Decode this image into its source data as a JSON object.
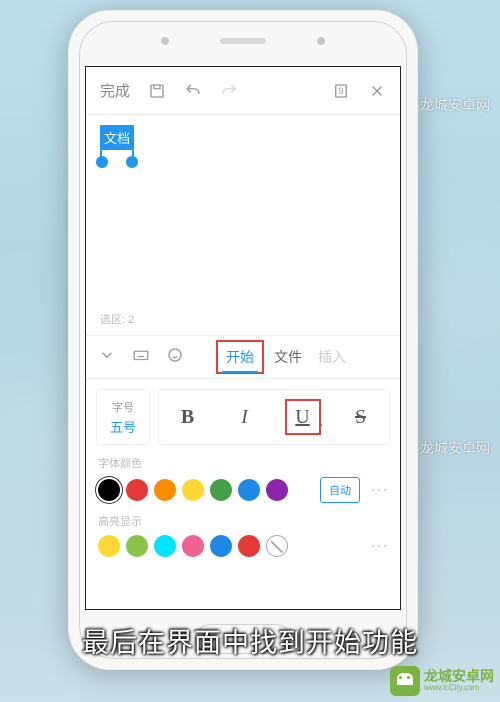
{
  "topbar": {
    "done": "完成",
    "page_count": "9"
  },
  "document": {
    "selected_text": "文档",
    "selection_info": "选区: 2"
  },
  "tabs": {
    "start": "开始",
    "file": "文件",
    "insert": "插入"
  },
  "font": {
    "size_label": "字号",
    "size_value": "五号"
  },
  "styles": {
    "bold": "B",
    "italic": "I",
    "underline": "U",
    "strike": "S"
  },
  "sections": {
    "font_color": "字体颜色",
    "highlight": "高亮显示",
    "auto": "自动"
  },
  "font_colors": [
    "#000000",
    "#e53935",
    "#fb8c00",
    "#fdd835",
    "#43a047",
    "#1e88e5",
    "#8e24aa"
  ],
  "highlight_colors": [
    "#fdd835",
    "#8bc34a",
    "#00e5ff",
    "#f06292",
    "#1e88e5",
    "#e53935"
  ],
  "subtitle": "最后在界面中找到开始功能",
  "watermark": "龙城安卓网",
  "brand": {
    "cn": "龙城安卓网",
    "en": "www.lcCity.com"
  }
}
